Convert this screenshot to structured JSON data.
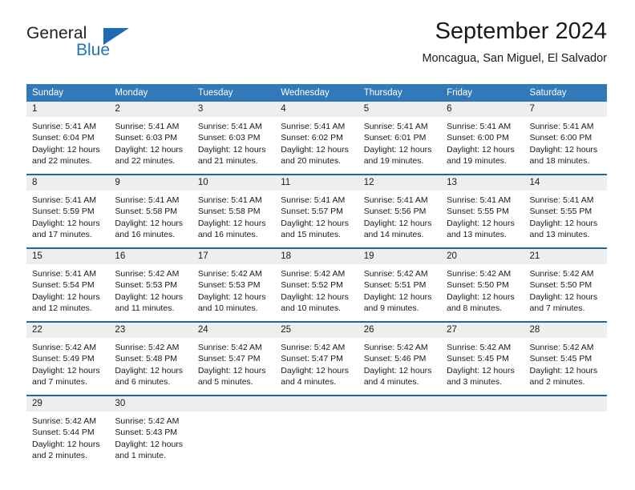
{
  "brand": {
    "name_part1": "General",
    "name_part2": "Blue",
    "accent_color": "#1b6cb4"
  },
  "header": {
    "title": "September 2024",
    "subtitle": "Moncagua, San Miguel, El Salvador"
  },
  "theme": {
    "header_bg": "#3179b8",
    "week_separator": "#2166ab",
    "daynum_bg": "#eeeeee",
    "text": "#1a1a1a"
  },
  "weekdays": [
    "Sunday",
    "Monday",
    "Tuesday",
    "Wednesday",
    "Thursday",
    "Friday",
    "Saturday"
  ],
  "weeks": [
    {
      "days": [
        {
          "num": "1",
          "sunrise": "Sunrise: 5:41 AM",
          "sunset": "Sunset: 6:04 PM",
          "daylight1": "Daylight: 12 hours",
          "daylight2": "and 22 minutes."
        },
        {
          "num": "2",
          "sunrise": "Sunrise: 5:41 AM",
          "sunset": "Sunset: 6:03 PM",
          "daylight1": "Daylight: 12 hours",
          "daylight2": "and 22 minutes."
        },
        {
          "num": "3",
          "sunrise": "Sunrise: 5:41 AM",
          "sunset": "Sunset: 6:03 PM",
          "daylight1": "Daylight: 12 hours",
          "daylight2": "and 21 minutes."
        },
        {
          "num": "4",
          "sunrise": "Sunrise: 5:41 AM",
          "sunset": "Sunset: 6:02 PM",
          "daylight1": "Daylight: 12 hours",
          "daylight2": "and 20 minutes."
        },
        {
          "num": "5",
          "sunrise": "Sunrise: 5:41 AM",
          "sunset": "Sunset: 6:01 PM",
          "daylight1": "Daylight: 12 hours",
          "daylight2": "and 19 minutes."
        },
        {
          "num": "6",
          "sunrise": "Sunrise: 5:41 AM",
          "sunset": "Sunset: 6:00 PM",
          "daylight1": "Daylight: 12 hours",
          "daylight2": "and 19 minutes."
        },
        {
          "num": "7",
          "sunrise": "Sunrise: 5:41 AM",
          "sunset": "Sunset: 6:00 PM",
          "daylight1": "Daylight: 12 hours",
          "daylight2": "and 18 minutes."
        }
      ]
    },
    {
      "days": [
        {
          "num": "8",
          "sunrise": "Sunrise: 5:41 AM",
          "sunset": "Sunset: 5:59 PM",
          "daylight1": "Daylight: 12 hours",
          "daylight2": "and 17 minutes."
        },
        {
          "num": "9",
          "sunrise": "Sunrise: 5:41 AM",
          "sunset": "Sunset: 5:58 PM",
          "daylight1": "Daylight: 12 hours",
          "daylight2": "and 16 minutes."
        },
        {
          "num": "10",
          "sunrise": "Sunrise: 5:41 AM",
          "sunset": "Sunset: 5:58 PM",
          "daylight1": "Daylight: 12 hours",
          "daylight2": "and 16 minutes."
        },
        {
          "num": "11",
          "sunrise": "Sunrise: 5:41 AM",
          "sunset": "Sunset: 5:57 PM",
          "daylight1": "Daylight: 12 hours",
          "daylight2": "and 15 minutes."
        },
        {
          "num": "12",
          "sunrise": "Sunrise: 5:41 AM",
          "sunset": "Sunset: 5:56 PM",
          "daylight1": "Daylight: 12 hours",
          "daylight2": "and 14 minutes."
        },
        {
          "num": "13",
          "sunrise": "Sunrise: 5:41 AM",
          "sunset": "Sunset: 5:55 PM",
          "daylight1": "Daylight: 12 hours",
          "daylight2": "and 13 minutes."
        },
        {
          "num": "14",
          "sunrise": "Sunrise: 5:41 AM",
          "sunset": "Sunset: 5:55 PM",
          "daylight1": "Daylight: 12 hours",
          "daylight2": "and 13 minutes."
        }
      ]
    },
    {
      "days": [
        {
          "num": "15",
          "sunrise": "Sunrise: 5:41 AM",
          "sunset": "Sunset: 5:54 PM",
          "daylight1": "Daylight: 12 hours",
          "daylight2": "and 12 minutes."
        },
        {
          "num": "16",
          "sunrise": "Sunrise: 5:42 AM",
          "sunset": "Sunset: 5:53 PM",
          "daylight1": "Daylight: 12 hours",
          "daylight2": "and 11 minutes."
        },
        {
          "num": "17",
          "sunrise": "Sunrise: 5:42 AM",
          "sunset": "Sunset: 5:53 PM",
          "daylight1": "Daylight: 12 hours",
          "daylight2": "and 10 minutes."
        },
        {
          "num": "18",
          "sunrise": "Sunrise: 5:42 AM",
          "sunset": "Sunset: 5:52 PM",
          "daylight1": "Daylight: 12 hours",
          "daylight2": "and 10 minutes."
        },
        {
          "num": "19",
          "sunrise": "Sunrise: 5:42 AM",
          "sunset": "Sunset: 5:51 PM",
          "daylight1": "Daylight: 12 hours",
          "daylight2": "and 9 minutes."
        },
        {
          "num": "20",
          "sunrise": "Sunrise: 5:42 AM",
          "sunset": "Sunset: 5:50 PM",
          "daylight1": "Daylight: 12 hours",
          "daylight2": "and 8 minutes."
        },
        {
          "num": "21",
          "sunrise": "Sunrise: 5:42 AM",
          "sunset": "Sunset: 5:50 PM",
          "daylight1": "Daylight: 12 hours",
          "daylight2": "and 7 minutes."
        }
      ]
    },
    {
      "days": [
        {
          "num": "22",
          "sunrise": "Sunrise: 5:42 AM",
          "sunset": "Sunset: 5:49 PM",
          "daylight1": "Daylight: 12 hours",
          "daylight2": "and 7 minutes."
        },
        {
          "num": "23",
          "sunrise": "Sunrise: 5:42 AM",
          "sunset": "Sunset: 5:48 PM",
          "daylight1": "Daylight: 12 hours",
          "daylight2": "and 6 minutes."
        },
        {
          "num": "24",
          "sunrise": "Sunrise: 5:42 AM",
          "sunset": "Sunset: 5:47 PM",
          "daylight1": "Daylight: 12 hours",
          "daylight2": "and 5 minutes."
        },
        {
          "num": "25",
          "sunrise": "Sunrise: 5:42 AM",
          "sunset": "Sunset: 5:47 PM",
          "daylight1": "Daylight: 12 hours",
          "daylight2": "and 4 minutes."
        },
        {
          "num": "26",
          "sunrise": "Sunrise: 5:42 AM",
          "sunset": "Sunset: 5:46 PM",
          "daylight1": "Daylight: 12 hours",
          "daylight2": "and 4 minutes."
        },
        {
          "num": "27",
          "sunrise": "Sunrise: 5:42 AM",
          "sunset": "Sunset: 5:45 PM",
          "daylight1": "Daylight: 12 hours",
          "daylight2": "and 3 minutes."
        },
        {
          "num": "28",
          "sunrise": "Sunrise: 5:42 AM",
          "sunset": "Sunset: 5:45 PM",
          "daylight1": "Daylight: 12 hours",
          "daylight2": "and 2 minutes."
        }
      ]
    },
    {
      "days": [
        {
          "num": "29",
          "sunrise": "Sunrise: 5:42 AM",
          "sunset": "Sunset: 5:44 PM",
          "daylight1": "Daylight: 12 hours",
          "daylight2": "and 2 minutes."
        },
        {
          "num": "30",
          "sunrise": "Sunrise: 5:42 AM",
          "sunset": "Sunset: 5:43 PM",
          "daylight1": "Daylight: 12 hours",
          "daylight2": "and 1 minute."
        },
        {
          "num": "",
          "sunrise": "",
          "sunset": "",
          "daylight1": "",
          "daylight2": ""
        },
        {
          "num": "",
          "sunrise": "",
          "sunset": "",
          "daylight1": "",
          "daylight2": ""
        },
        {
          "num": "",
          "sunrise": "",
          "sunset": "",
          "daylight1": "",
          "daylight2": ""
        },
        {
          "num": "",
          "sunrise": "",
          "sunset": "",
          "daylight1": "",
          "daylight2": ""
        },
        {
          "num": "",
          "sunrise": "",
          "sunset": "",
          "daylight1": "",
          "daylight2": ""
        }
      ]
    }
  ]
}
